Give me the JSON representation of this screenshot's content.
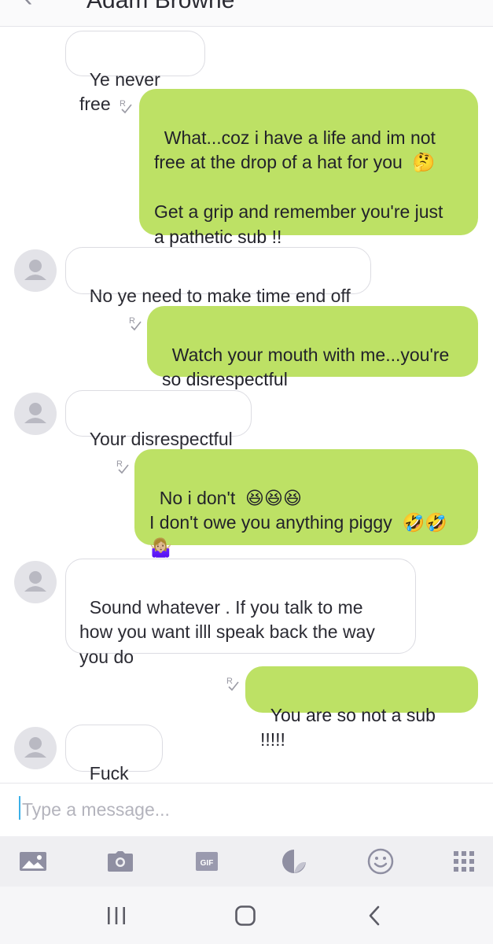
{
  "header": {
    "title": "Adam Browne",
    "back_icon": "‹"
  },
  "messages": [
    {
      "dir": "in",
      "text": "Ye never free",
      "avatar": false
    },
    {
      "dir": "out",
      "text": "What...coz i have a life and im not\nfree at the drop of a hat for you  🤔\n\nGet a grip and remember you're just\na pathetic sub !!"
    },
    {
      "dir": "in",
      "text": "No ye need to make time end off",
      "avatar": true
    },
    {
      "dir": "out",
      "text": "Watch your mouth with me...you're\nso disrespectful"
    },
    {
      "dir": "in",
      "text": "Your disrespectful",
      "avatar": true
    },
    {
      "dir": "out",
      "text": "No i don't  😆😆😆\nI don't owe you anything piggy  🤣🤣\n🤷🏼‍♀️"
    },
    {
      "dir": "in",
      "text": "Sound whatever . If you talk to me\nhow you want illl speak back the way\nyou do",
      "avatar": true
    },
    {
      "dir": "out",
      "text": "You are so not a sub !!!!!"
    },
    {
      "dir": "in",
      "text": "Fuck off",
      "avatar": true
    }
  ],
  "composer": {
    "placeholder": "Type a message...",
    "value": ""
  },
  "toolbar": [
    {
      "icon": "gallery-icon"
    },
    {
      "icon": "camera-icon"
    },
    {
      "icon": "gif-icon",
      "label": "GIF"
    },
    {
      "icon": "sticker-icon"
    },
    {
      "icon": "emoji-icon"
    },
    {
      "icon": "grid-menu-icon"
    }
  ],
  "colors": {
    "outgoing": "#bde165",
    "incoming_border": "#dcdce2",
    "accent": "#3ab0e8"
  }
}
